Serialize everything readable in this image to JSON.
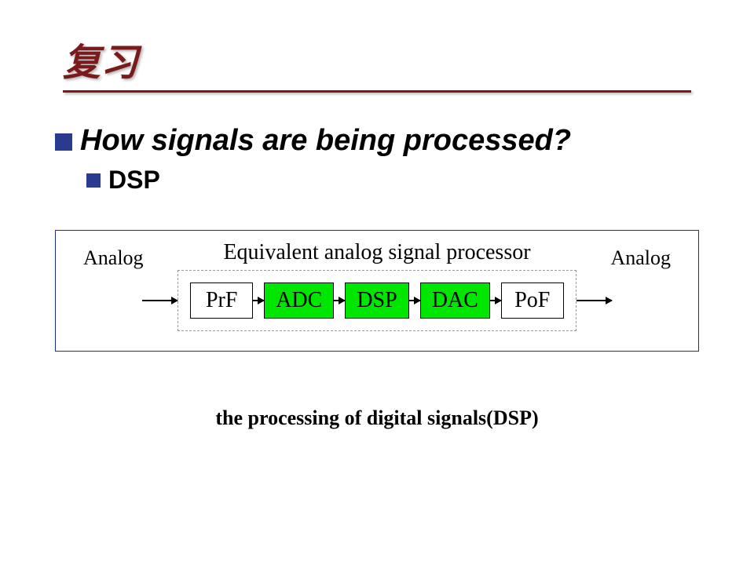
{
  "title": "复习",
  "bullets": {
    "level1": "How signals are being processed?",
    "level2": "DSP"
  },
  "diagram": {
    "title": "Equivalent analog signal processor",
    "left_label": "Analog",
    "right_label": "Analog",
    "blocks": {
      "prf": "PrF",
      "adc": "ADC",
      "dsp": "DSP",
      "dac": "DAC",
      "pof": "PoF"
    }
  },
  "footnote": "the processing  of digital signals(DSP)"
}
